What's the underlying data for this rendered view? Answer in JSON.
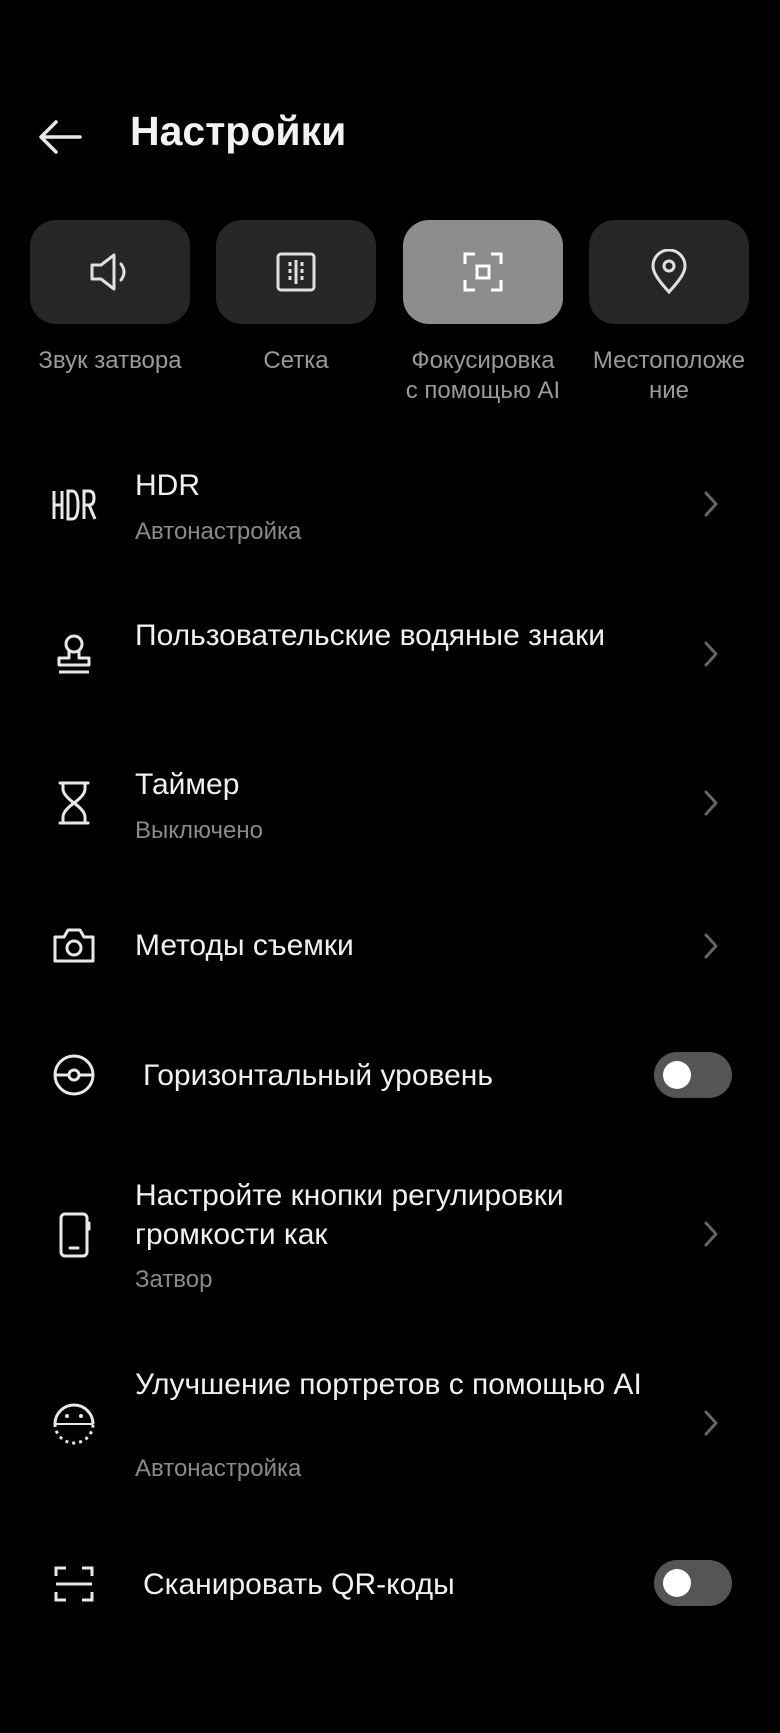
{
  "header": {
    "title": "Настройки",
    "back_icon": "arrow-left-icon"
  },
  "tiles": [
    {
      "label": "Звук затвора",
      "icon": "speaker-icon",
      "active": false
    },
    {
      "label": "Сетка",
      "icon": "grid-icon",
      "active": false
    },
    {
      "label": "Фокусировка\nс помощью AI",
      "icon": "focus-frame-icon",
      "active": true
    },
    {
      "label": "Местоположе\nние",
      "icon": "location-pin-icon",
      "active": false
    }
  ],
  "items": [
    {
      "title": "HDR",
      "subtitle": "Автонастройка",
      "icon": "hdr-icon"
    },
    {
      "title": "Пользовательские водяные знаки",
      "icon": "watermark-stamp-icon"
    },
    {
      "title": "Таймер",
      "subtitle": "Выключено",
      "icon": "hourglass-icon"
    },
    {
      "title": "Методы съемки",
      "icon": "camera-icon"
    },
    {
      "title": "Горизонтальный уровень",
      "icon": "level-icon",
      "toggle": false
    },
    {
      "title": "Настройте кнопки регулировки громкости как",
      "subtitle": "Затвор",
      "icon": "phone-icon"
    },
    {
      "title": "Улучшение портретов с помощью AI",
      "subtitle": "Автонастройка",
      "icon": "face-icon"
    },
    {
      "title": "Сканировать QR-коды",
      "icon": "scan-icon",
      "toggle": false
    }
  ],
  "colors": {
    "background": "#000000",
    "tile": "#262626",
    "tile_active": "#8d8d8d",
    "secondary_text": "#8a8a8a",
    "toggle_off": "#555555"
  }
}
